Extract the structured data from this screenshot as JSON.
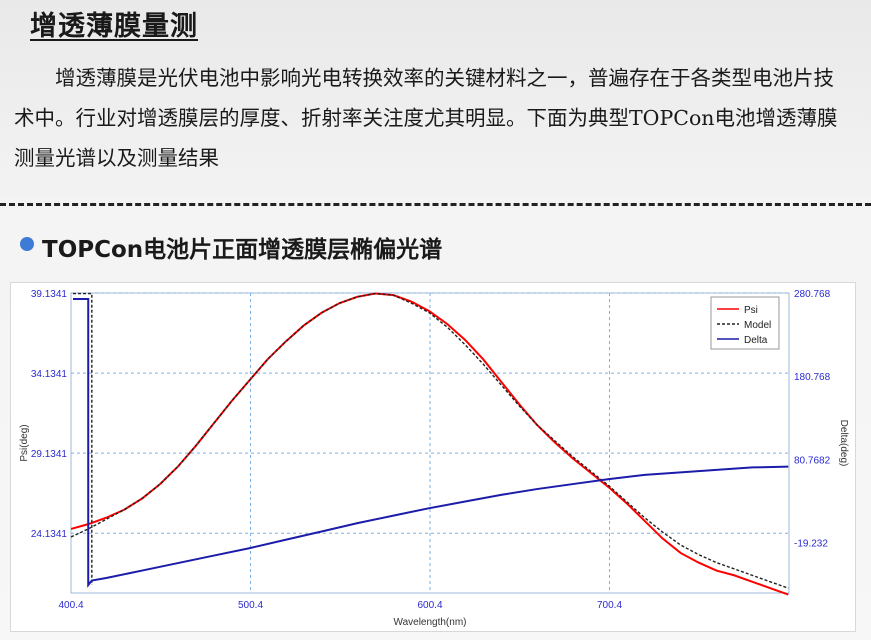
{
  "header": {
    "title": "增透薄膜量测"
  },
  "intro": {
    "text": "增透薄膜是光伏电池中影响光电转换效率的关键材料之一，普遍存在于各类型电池片技术中。行业对增透膜层的厚度、折射率关注度尤其明显。下面为典型TOPCon电池增透薄膜测量光谱以及测量结果"
  },
  "section": {
    "title": "TOPCon电池片正面增透膜层椭偏光谱"
  },
  "colors": {
    "psi": "#ff0000",
    "model": "#222222",
    "delta": "#1c1caa",
    "grid": "#7fb0e6",
    "tick": "#2a2ad0",
    "bullet": "#3d7bd6"
  },
  "chart_data": {
    "type": "line",
    "xlabel": "Wavelength(nm)",
    "ylabel": "Psi(deg)",
    "y2label": "Delta(deg)",
    "xlim": [
      400.4,
      800.4
    ],
    "ylim": [
      20.4,
      39.1341
    ],
    "y2lim": [
      -80,
      280.768
    ],
    "xticks": [
      "400.4",
      "500.4",
      "600.4",
      "700.4"
    ],
    "yticks": [
      "24.1341",
      "29.1341",
      "34.1341",
      "39.1341"
    ],
    "y2ticks": [
      "-19.232",
      "80.7682",
      "180.768",
      "280.768"
    ],
    "legend_position": "top-right",
    "grid": true,
    "series": [
      {
        "name": "Psi",
        "axis": "left",
        "style": "solid",
        "x": [
          400.4,
          410,
          420,
          430,
          440,
          450,
          460,
          470,
          480,
          490,
          500,
          510,
          520,
          530,
          540,
          550,
          560,
          570,
          580,
          590,
          600,
          610,
          620,
          630,
          640,
          650,
          660,
          670,
          680,
          690,
          700,
          710,
          720,
          730,
          740,
          750,
          760,
          770,
          780,
          790,
          800
        ],
        "y": [
          24.4,
          24.7,
          25.1,
          25.6,
          26.3,
          27.2,
          28.3,
          29.6,
          31.0,
          32.4,
          33.7,
          35.0,
          36.1,
          37.1,
          37.9,
          38.5,
          38.9,
          39.1,
          39.0,
          38.6,
          38.0,
          37.2,
          36.2,
          35.0,
          33.6,
          32.2,
          30.9,
          29.8,
          28.8,
          27.9,
          27.0,
          26.0,
          24.9,
          23.8,
          22.9,
          22.3,
          21.8,
          21.5,
          21.1,
          20.7,
          20.3
        ]
      },
      {
        "name": "Model",
        "axis": "left",
        "style": "dashed",
        "x": [
          400.4,
          410,
          420,
          430,
          440,
          450,
          460,
          470,
          480,
          490,
          500,
          510,
          520,
          530,
          540,
          550,
          560,
          570,
          580,
          590,
          600,
          610,
          620,
          630,
          640,
          650,
          660,
          670,
          680,
          690,
          700,
          710,
          720,
          730,
          740,
          750,
          760,
          770,
          780,
          790,
          800
        ],
        "y": [
          23.9,
          24.4,
          25.0,
          25.6,
          26.3,
          27.2,
          28.3,
          29.6,
          31.0,
          32.4,
          33.7,
          35.0,
          36.1,
          37.1,
          37.9,
          38.5,
          38.9,
          39.1,
          39.0,
          38.5,
          37.9,
          37.0,
          35.9,
          34.7,
          33.4,
          32.1,
          30.9,
          29.9,
          28.9,
          28.0,
          27.1,
          26.1,
          25.1,
          24.2,
          23.4,
          22.8,
          22.3,
          21.9,
          21.5,
          21.1,
          20.7
        ]
      },
      {
        "name": "Delta",
        "axis": "right",
        "style": "solid",
        "x": [
          400.4,
          412,
          420,
          440,
          460,
          480,
          500,
          520,
          540,
          560,
          580,
          600,
          620,
          640,
          660,
          680,
          700,
          720,
          740,
          760,
          780,
          800
        ],
        "y": [
          -70,
          -65,
          -62,
          -53,
          -44,
          -35,
          -26,
          -16,
          -6,
          4,
          13,
          22,
          30,
          38,
          45,
          51,
          57,
          62,
          65,
          68,
          71,
          72
        ]
      }
    ],
    "step_annotation": {
      "psi_at_start": 39.1,
      "delta_at_start": 280.768
    }
  }
}
